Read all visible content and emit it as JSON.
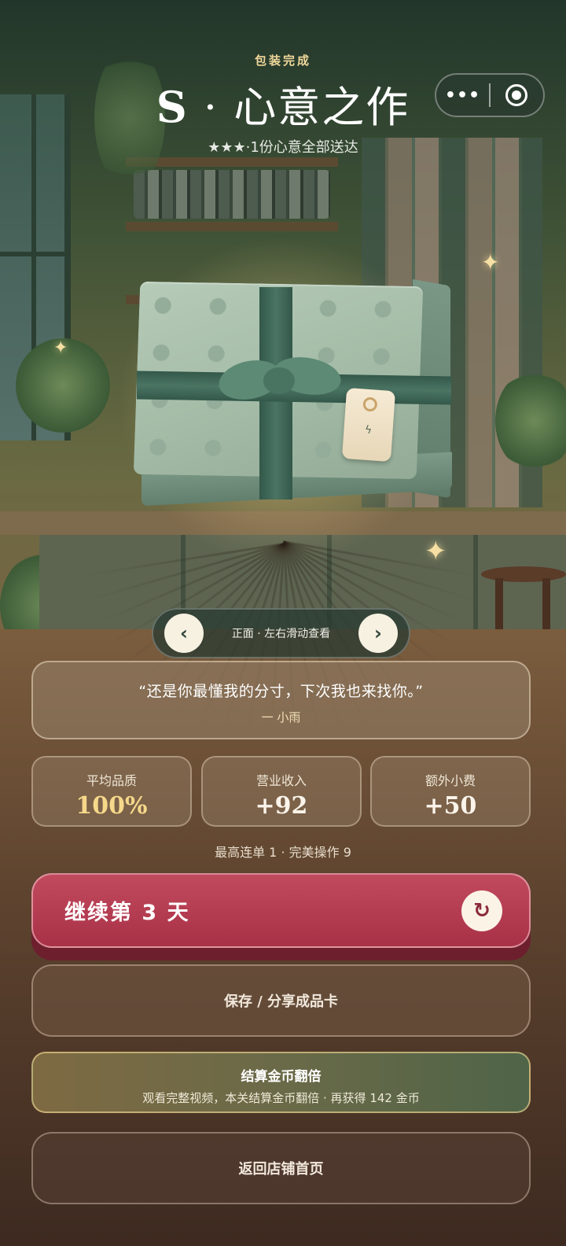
{
  "header": {
    "status_label": "包装完成",
    "grade": "S",
    "title_separator": "·",
    "title": "心意之作",
    "rating_stars": "★★★",
    "rating_text": "·1份心意全部送达"
  },
  "capsule": {
    "more_icon": "more-dots-icon",
    "more_glyph": "•••",
    "close_icon": "target-close-icon"
  },
  "gift_view": {
    "prev_glyph": "‹",
    "next_glyph": "›",
    "label": "正面 · 左右滑动查看",
    "tag_mark": "ϟ"
  },
  "review": {
    "quote": "“还是你最懂我的分寸，下次我也来找你。”",
    "author": "一 小雨"
  },
  "stats": [
    {
      "label": "平均品质",
      "value": "100%"
    },
    {
      "label": "营业收入",
      "value": "+92"
    },
    {
      "label": "额外小费",
      "value": "+50"
    }
  ],
  "combo_line": "最高连单 1 · 完美操作 9",
  "actions": {
    "continue_label": "继续第 3 天",
    "continue_icon_glyph": "↻",
    "share_label": "保存 / 分享成品卡",
    "double_title": "结算金币翻倍",
    "double_desc": "观看完整视频，本关结算金币翻倍 · 再获得 142 金币",
    "home_label": "返回店铺首页"
  },
  "colors": {
    "accent_gold": "#f6d88a",
    "continue_red": "#b63c51",
    "dark_green": "#33584a"
  }
}
